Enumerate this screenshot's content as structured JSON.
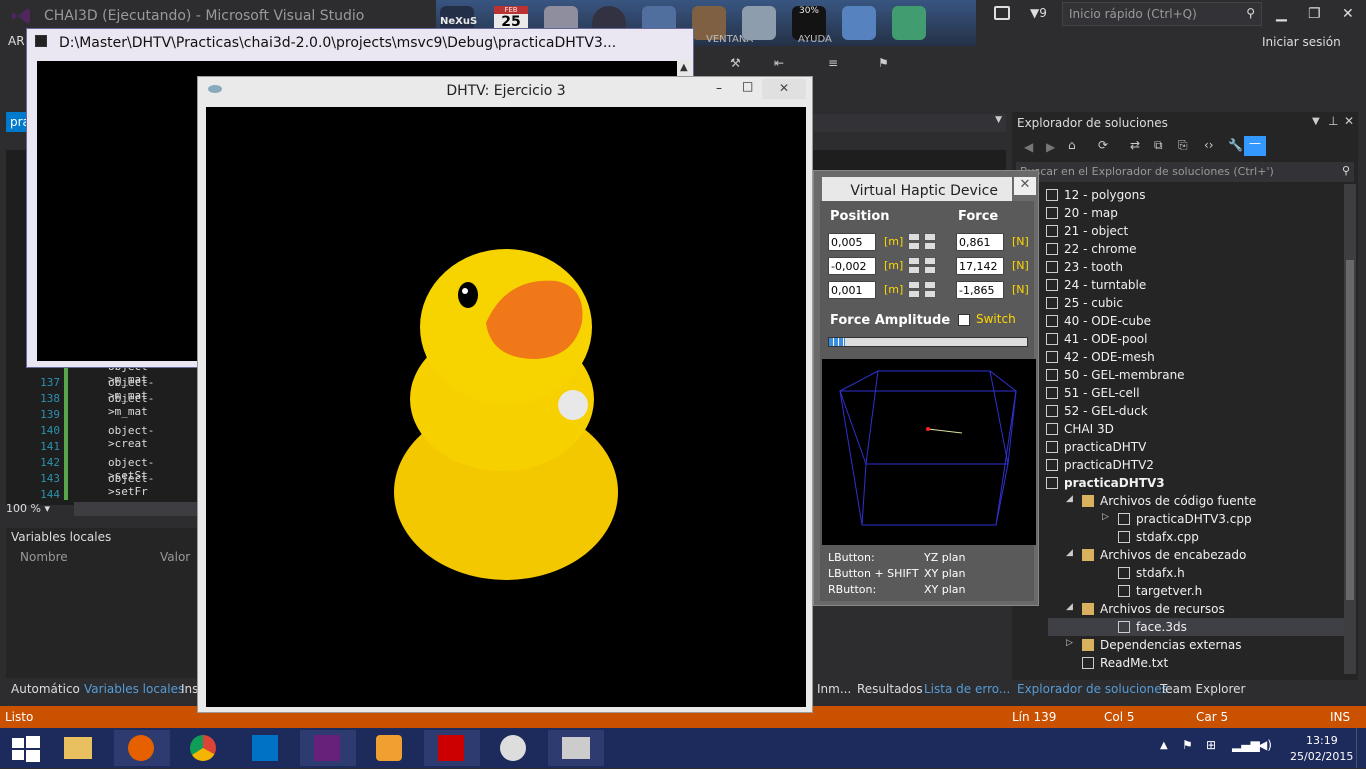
{
  "vs": {
    "title": "CHAI3D (Ejecutando) - Microsoft Visual Studio",
    "quick_launch": "Inicio rápido (Ctrl+Q)",
    "notif_count": "9",
    "sign_in": "Iniciar sesión",
    "menu_fragment": "AR",
    "left_tab_fragment": "pra",
    "zoom": "100 %",
    "code_lines": [
      {
        "n": "137",
        "code": "object->m_mat"
      },
      {
        "n": "138",
        "code": "object->m_mat"
      },
      {
        "n": "139",
        "code": ""
      },
      {
        "n": "140",
        "code": "object->creat"
      },
      {
        "n": "141",
        "code": ""
      },
      {
        "n": "142",
        "code": "object->setSt"
      },
      {
        "n": "143",
        "code": "object->setFr"
      },
      {
        "n": "144",
        "code": ""
      }
    ],
    "first_partial_code": "object->m_mat",
    "locals": {
      "title": "Variables locales",
      "col_name": "Nombre",
      "col_value": "Valor"
    },
    "bottom_tabs": [
      "Automático",
      "Variables locales",
      "Ins",
      "Inm...",
      "Resultados",
      "Lista de erro..."
    ],
    "status": {
      "left": "Listo",
      "line": "Lín 139",
      "col": "Col 5",
      "car": "Car 5",
      "ins": "INS"
    }
  },
  "dock": {
    "nexus": "NeXuS",
    "cal_month": "FEB",
    "cal_day": "25",
    "cpu": "30%",
    "ventana": "VENTANA",
    "ayuda": "AYUDA"
  },
  "console": {
    "title": "D:\\Master\\DHTV\\Practicas\\chai3d-2.0.0\\projects\\msvc9\\Debug\\practicaDHTV3..."
  },
  "dhtv": {
    "title": "DHTV: Ejercicio 3"
  },
  "vhd": {
    "title": "Virtual Haptic Device",
    "position_label": "Position",
    "force_label": "Force",
    "position": [
      "0,005",
      "-0,002",
      "0,001"
    ],
    "force": [
      "0,861",
      "17,142",
      "-1,865"
    ],
    "unit_m": "[m]",
    "unit_n": "[N]",
    "force_amplitude_label": "Force Amplitude",
    "switch_label": "Switch",
    "amplitude_fraction": 0.08,
    "help": [
      {
        "k": "LButton:",
        "v": "YZ plan"
      },
      {
        "k": "LButton + SHIFT",
        "v": "XY plan"
      },
      {
        "k": "RButton:",
        "v": "XY plan"
      }
    ]
  },
  "solution": {
    "title": "Explorador de soluciones",
    "search": "Buscar en el Explorador de soluciones (Ctrl+')",
    "items": [
      {
        "label": "12 - polygons"
      },
      {
        "label": "20 - map"
      },
      {
        "label": "21 - object"
      },
      {
        "label": "22 - chrome"
      },
      {
        "label": "23 - tooth"
      },
      {
        "label": "24 - turntable"
      },
      {
        "label": "25 - cubic"
      },
      {
        "label": "40 - ODE-cube"
      },
      {
        "label": "41 - ODE-pool"
      },
      {
        "label": "42 - ODE-mesh"
      },
      {
        "label": "50 - GEL-membrane"
      },
      {
        "label": "51 - GEL-cell"
      },
      {
        "label": "52 - GEL-duck"
      },
      {
        "label": "CHAI 3D"
      },
      {
        "label": "practicaDHTV"
      },
      {
        "label": "practicaDHTV2"
      },
      {
        "label": "practicaDHTV3"
      },
      {
        "label": "Archivos de código fuente"
      },
      {
        "label": "practicaDHTV3.cpp"
      },
      {
        "label": "stdafx.cpp"
      },
      {
        "label": "Archivos de encabezado"
      },
      {
        "label": "stdafx.h"
      },
      {
        "label": "targetver.h"
      },
      {
        "label": "Archivos de recursos"
      },
      {
        "label": "face.3ds"
      },
      {
        "label": "Dependencias externas"
      },
      {
        "label": "ReadMe.txt"
      }
    ],
    "tabs": [
      "Explorador de soluciones",
      "Team Explorer"
    ]
  },
  "taskbar": {
    "time": "13:19",
    "date": "25/02/2015"
  },
  "colors": {
    "accent": "#ca5100",
    "link": "#569cd6",
    "duck": "#f7d000",
    "beak": "#f07818",
    "grid": "#3030d0"
  }
}
